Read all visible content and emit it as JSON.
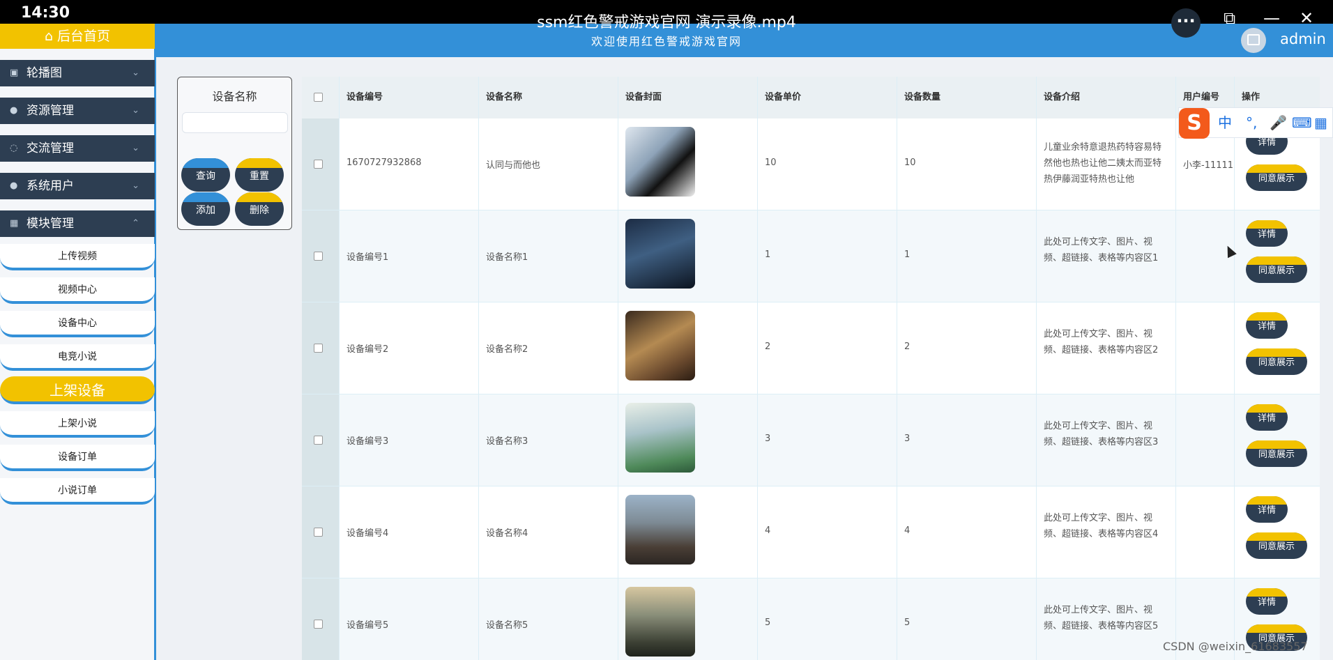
{
  "video": {
    "time": "14:30",
    "title": "ssm红色警戒游戏官网 演示录像.mp4",
    "more": "···",
    "pip": "⧉",
    "minimize": "—",
    "close": "✕"
  },
  "header": {
    "subtitle": "欢迎使用红色警戒游戏官网",
    "user": "admin"
  },
  "sidebar": {
    "home": "后台首页",
    "groups": [
      {
        "label": "轮播图",
        "icon": "image-icon"
      },
      {
        "label": "资源管理",
        "icon": "pin-icon"
      },
      {
        "label": "交流管理",
        "icon": "chat-icon"
      },
      {
        "label": "系统用户",
        "icon": "user-icon"
      },
      {
        "label": "模块管理",
        "icon": "grid-icon"
      }
    ],
    "items": [
      "上传视频",
      "视频中心",
      "设备中心",
      "电竞小说",
      "上架设备",
      "上架小说",
      "设备订单",
      "小说订单"
    ],
    "active_item": "上架设备"
  },
  "search": {
    "label": "设备名称",
    "placeholder": "",
    "query_btn": "查询",
    "reset_btn": "重置",
    "add_btn": "添加",
    "delete_btn": "删除"
  },
  "table": {
    "headers": [
      "设备编号",
      "设备名称",
      "设备封面",
      "设备单价",
      "设备数量",
      "设备介绍",
      "用户编号",
      "操作"
    ],
    "rows": [
      {
        "id": "1670727932868",
        "name": "认同与而他也",
        "price": "10",
        "qty": "10",
        "intro": "儿童业余特意退热药特容易特然他也热也让他二姨太而亚特热伊藤润亚特热也让他",
        "user": "小李-11111"
      },
      {
        "id": "设备编号1",
        "name": "设备名称1",
        "price": "1",
        "qty": "1",
        "intro": "此处可上传文字、图片、视频、超链接、表格等内容区1",
        "user": ""
      },
      {
        "id": "设备编号2",
        "name": "设备名称2",
        "price": "2",
        "qty": "2",
        "intro": "此处可上传文字、图片、视频、超链接、表格等内容区2",
        "user": ""
      },
      {
        "id": "设备编号3",
        "name": "设备名称3",
        "price": "3",
        "qty": "3",
        "intro": "此处可上传文字、图片、视频、超链接、表格等内容区3",
        "user": ""
      },
      {
        "id": "设备编号4",
        "name": "设备名称4",
        "price": "4",
        "qty": "4",
        "intro": "此处可上传文字、图片、视频、超链接、表格等内容区4",
        "user": ""
      },
      {
        "id": "设备编号5",
        "name": "设备名称5",
        "price": "5",
        "qty": "5",
        "intro": "此处可上传文字、图片、视频、超链接、表格等内容区5",
        "user": ""
      }
    ],
    "detail_btn": "详情",
    "approve_btn": "同意展示"
  },
  "ime": {
    "logo": "S",
    "lang": "中",
    "punct": "°,",
    "mic": "🎤",
    "keyboard": "⌨",
    "apps": "▦"
  },
  "watermark": "CSDN @weixin_61683557"
}
